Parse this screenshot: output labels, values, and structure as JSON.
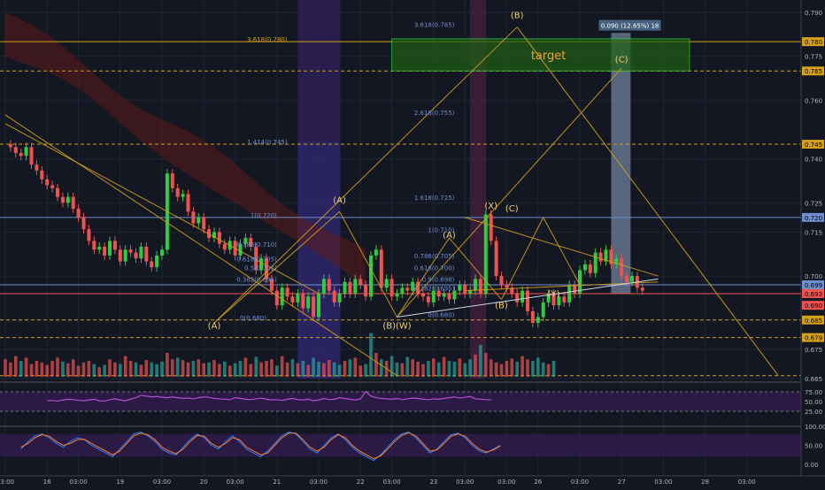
{
  "theme": {
    "background": "#131722",
    "grid": "#1e2433",
    "bull": "#26a69a",
    "bull_bright": "#2ecc40",
    "bear": "#ef5350",
    "pattern": "#d4a017",
    "fib": "#6f8fd0",
    "cloud": "#5c1a1a",
    "target_box": "#1f5f14",
    "target_border": "#2ecc40",
    "rsi_band": "#3a1d5c",
    "rsi_line": "#b050d0",
    "stoch_k": "#2a7fff",
    "stoch_d": "#ff7f2a",
    "projection_box": "#8fa6c8"
  },
  "chart_data": {
    "type": "candlestick",
    "title": "",
    "xlabel": "",
    "ylabel": "",
    "ylim": [
      0.665,
      0.79
    ],
    "x_ticks": [
      "03:00",
      "16",
      "03:00",
      "19",
      "03:00",
      "20",
      "03:00",
      "21",
      "03:00",
      "22",
      "03:00",
      "23",
      "03:00",
      "03:00",
      "26",
      "03:00",
      "27",
      "03:00",
      "28",
      "03:00"
    ],
    "x_tick_index": [
      0,
      8,
      14,
      22,
      30,
      38,
      44,
      52,
      60,
      68,
      74,
      82,
      88,
      96,
      102,
      110,
      118,
      126,
      134,
      142
    ],
    "y_ticks": [
      "0.790",
      "0.775",
      "0.760",
      "0.740",
      "0.725",
      "0.715",
      "0.700",
      "0.685",
      "0.675",
      "0.665"
    ],
    "y_tick_values": [
      0.79,
      0.775,
      0.76,
      0.74,
      0.725,
      0.715,
      0.7,
      0.685,
      0.675,
      0.665
    ],
    "price_tags": [
      {
        "value": 0.78,
        "text": "0.780",
        "color": "#d4a017"
      },
      {
        "value": 0.77,
        "text": "0.765",
        "color": "#d4a017"
      },
      {
        "value": 0.745,
        "text": "0.745",
        "color": "#d4a017"
      },
      {
        "value": 0.72,
        "text": "0.720",
        "color": "#6f8fd0"
      },
      {
        "value": 0.697,
        "text": "0.699",
        "color": "#6f8fd0"
      },
      {
        "value": 0.694,
        "text": "0.693",
        "color": "#ef5350"
      },
      {
        "value": 0.69,
        "text": "0.690",
        "color": "#ef5350"
      },
      {
        "value": 0.685,
        "text": "0.685",
        "color": "#d4a017"
      },
      {
        "value": 0.679,
        "text": "0.679",
        "color": "#d4a017"
      }
    ],
    "horizontal_lines": [
      {
        "value": 0.78,
        "style": "solid",
        "color": "#d4a017"
      },
      {
        "value": 0.77,
        "style": "dashed",
        "color": "#d4a017"
      },
      {
        "value": 0.745,
        "style": "dashed",
        "color": "#d4a017"
      },
      {
        "value": 0.72,
        "style": "solid",
        "color": "#6f8fd0"
      },
      {
        "value": 0.697,
        "style": "solid",
        "color": "#6f8fd0"
      },
      {
        "value": 0.694,
        "style": "solid",
        "color": "#ef5350"
      },
      {
        "value": 0.685,
        "style": "dashed",
        "color": "#d4a017"
      },
      {
        "value": 0.679,
        "style": "dashed",
        "color": "#d4a017"
      },
      {
        "value": 0.666,
        "style": "dashed",
        "color": "#d4a017"
      }
    ],
    "closes": [
      0.745,
      0.744,
      0.742,
      0.741,
      0.744,
      0.738,
      0.736,
      0.733,
      0.731,
      0.73,
      0.727,
      0.725,
      0.727,
      0.723,
      0.72,
      0.716,
      0.712,
      0.709,
      0.71,
      0.707,
      0.712,
      0.709,
      0.705,
      0.709,
      0.708,
      0.706,
      0.71,
      0.705,
      0.703,
      0.707,
      0.709,
      0.735,
      0.73,
      0.727,
      0.728,
      0.722,
      0.718,
      0.72,
      0.716,
      0.713,
      0.715,
      0.711,
      0.709,
      0.712,
      0.707,
      0.711,
      0.713,
      0.71,
      0.702,
      0.706,
      0.699,
      0.695,
      0.69,
      0.696,
      0.693,
      0.691,
      0.694,
      0.689,
      0.693,
      0.686,
      0.694,
      0.699,
      0.695,
      0.691,
      0.694,
      0.698,
      0.694,
      0.699,
      0.697,
      0.693,
      0.707,
      0.709,
      0.696,
      0.699,
      0.693,
      0.694,
      0.696,
      0.695,
      0.698,
      0.694,
      0.693,
      0.691,
      0.695,
      0.693,
      0.694,
      0.692,
      0.695,
      0.697,
      0.694,
      0.695,
      0.699,
      0.694,
      0.721,
      0.712,
      0.7,
      0.697,
      0.696,
      0.694,
      0.691,
      0.695,
      0.688,
      0.684,
      0.686,
      0.691,
      0.694,
      0.69,
      0.693,
      0.691,
      0.697,
      0.694,
      0.702,
      0.704,
      0.701,
      0.708,
      0.705,
      0.709,
      0.704,
      0.706,
      0.7,
      0.698,
      0.7,
      0.696,
      0.695
    ],
    "volumes": [
      22,
      18,
      26,
      20,
      24,
      16,
      20,
      18,
      15,
      20,
      24,
      19,
      17,
      22,
      14,
      18,
      20,
      16,
      12,
      15,
      22,
      18,
      16,
      26,
      20,
      18,
      15,
      21,
      18,
      16,
      19,
      30,
      22,
      24,
      21,
      18,
      20,
      22,
      17,
      18,
      21,
      16,
      19,
      14,
      17,
      20,
      24,
      16,
      25,
      18,
      20,
      22,
      14,
      26,
      18,
      22,
      17,
      20,
      15,
      24,
      19,
      17,
      21,
      18,
      15,
      20,
      22,
      24,
      14,
      16,
      55,
      30,
      22,
      20,
      26,
      18,
      17,
      25,
      22,
      19,
      16,
      20,
      23,
      18,
      25,
      20,
      19,
      23,
      17,
      22,
      28,
      40,
      30,
      22,
      18,
      16,
      20,
      23,
      19,
      26,
      22,
      20,
      24,
      18,
      16,
      20
    ],
    "fib_levels": [
      {
        "text": "1(0.720)",
        "value": 0.72
      },
      {
        "text": "0.786(0.710)",
        "value": 0.71
      },
      {
        "text": "0.618(0.705)",
        "value": 0.705
      },
      {
        "text": "0.5(0.702)",
        "value": 0.702
      },
      {
        "text": "0.382(0.695)",
        "value": 0.698
      },
      {
        "text": "0(0.680)",
        "value": 0.685
      },
      {
        "text": "1.414(0.745)",
        "value": 0.745
      },
      {
        "text": "3.618(0.780)",
        "value": 0.78
      },
      {
        "text": "1(0.710)",
        "value": 0.715
      },
      {
        "text": "0.786(0.705)",
        "value": 0.706
      },
      {
        "text": "0.618(0.700)",
        "value": 0.702
      },
      {
        "text": "0.5(0.698)",
        "value": 0.698
      },
      {
        "text": "0.382(0.695)",
        "value": 0.695
      },
      {
        "text": "0(0.680)",
        "value": 0.686
      },
      {
        "text": "1.618(0.725)",
        "value": 0.726
      },
      {
        "text": "2.618(0.755)",
        "value": 0.755
      },
      {
        "text": "3.618(0.785)",
        "value": 0.785
      }
    ],
    "wave_labels": [
      {
        "text": "(A)",
        "x_index": 40,
        "value": 0.682
      },
      {
        "text": "(A)",
        "x_index": 64,
        "value": 0.725
      },
      {
        "text": "(B)(W)",
        "x_index": 75,
        "value": 0.682
      },
      {
        "text": "(A)",
        "x_index": 85,
        "value": 0.713
      },
      {
        "text": "(B)",
        "x_index": 95,
        "value": 0.689
      },
      {
        "text": "(X)",
        "x_index": 93,
        "value": 0.723
      },
      {
        "text": "(C)",
        "x_index": 97,
        "value": 0.722
      },
      {
        "text": "(Y)",
        "x_index": 105,
        "value": 0.693
      },
      {
        "text": "(B)",
        "x_index": 98,
        "value": 0.788
      },
      {
        "text": "(C)",
        "x_index": 118,
        "value": 0.773
      }
    ],
    "target_label": "target",
    "measure_label": "0.090 (12.65%) 18",
    "rsi": {
      "y_ticks": [
        "75.00",
        "50.00",
        "25.00"
      ],
      "values": [
        52,
        53,
        51,
        54,
        56,
        55,
        53,
        52,
        54,
        56,
        52,
        51,
        55,
        57,
        54,
        52,
        56,
        60,
        66,
        64,
        62,
        63,
        61,
        60,
        62,
        60,
        58,
        59,
        57,
        60,
        62,
        61,
        58,
        57,
        56,
        55,
        60,
        58,
        56,
        55,
        57,
        59,
        56,
        54,
        55,
        53,
        56,
        58,
        55,
        54,
        56,
        52,
        54,
        58,
        55,
        56,
        60,
        58,
        56,
        54,
        57,
        76,
        64,
        60,
        58,
        57,
        56,
        58,
        55,
        57,
        59,
        58,
        56,
        55,
        57,
        56,
        58,
        60,
        62,
        59,
        61,
        63,
        57,
        56,
        55,
        54
      ]
    },
    "stoch": {
      "y_ticks": [
        "100.00",
        "50.00",
        "0.00"
      ],
      "k": [
        40,
        60,
        75,
        80,
        70,
        55,
        45,
        60,
        70,
        65,
        50,
        40,
        30,
        20,
        40,
        60,
        80,
        85,
        75,
        60,
        40,
        30,
        25,
        45,
        65,
        80,
        70,
        50,
        40,
        60,
        75,
        60,
        40,
        30,
        20,
        35,
        55,
        75,
        85,
        80,
        60,
        40,
        30,
        50,
        70,
        80,
        65,
        45,
        30,
        20,
        10,
        25,
        45,
        65,
        80,
        85,
        70,
        50,
        30,
        40,
        60,
        78,
        82,
        70,
        50,
        35,
        30,
        40,
        50
      ],
      "d": [
        45,
        55,
        70,
        78,
        74,
        60,
        50,
        55,
        65,
        66,
        55,
        45,
        35,
        25,
        35,
        55,
        75,
        82,
        78,
        65,
        45,
        35,
        28,
        40,
        60,
        76,
        74,
        55,
        45,
        55,
        70,
        65,
        45,
        35,
        25,
        30,
        50,
        70,
        82,
        82,
        65,
        45,
        35,
        45,
        65,
        78,
        70,
        50,
        35,
        25,
        15,
        22,
        40,
        60,
        76,
        83,
        75,
        55,
        35,
        38,
        55,
        74,
        80,
        74,
        55,
        40,
        32,
        38,
        48
      ]
    }
  }
}
